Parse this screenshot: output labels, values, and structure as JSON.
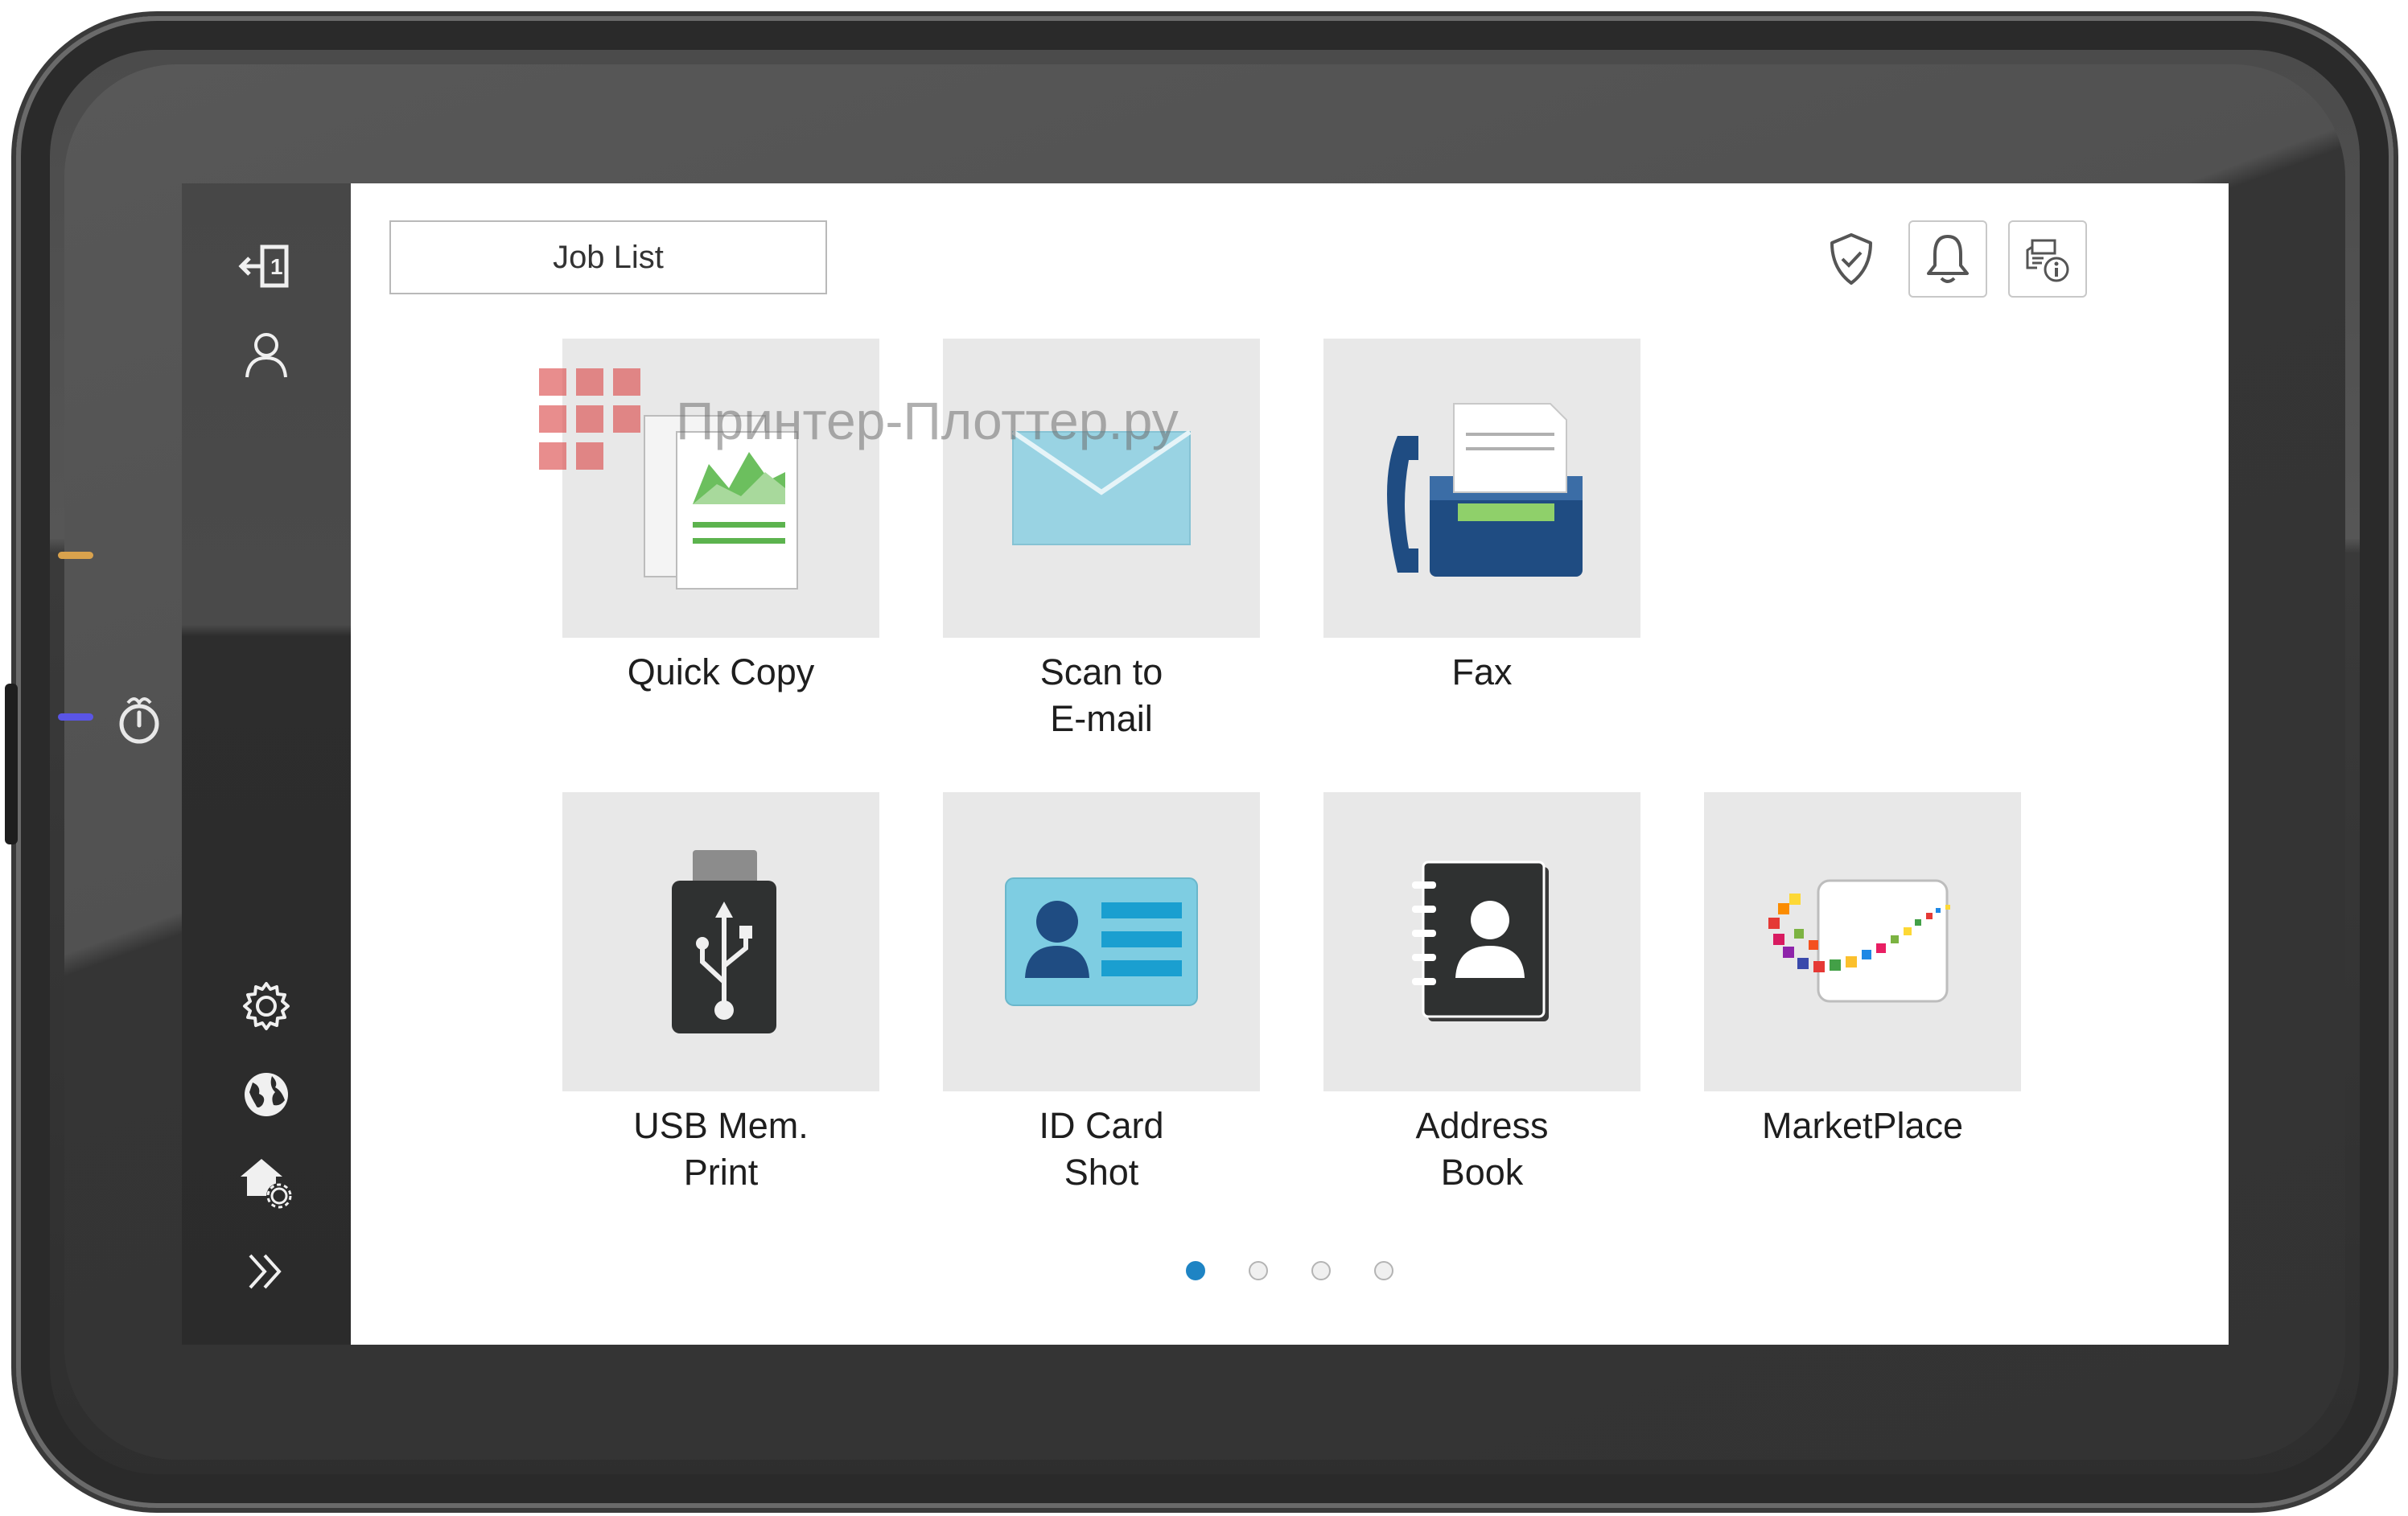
{
  "header": {
    "job_list_label": "Job List"
  },
  "watermark": {
    "text": "Принтер-Плоттер.ру"
  },
  "tiles": [
    {
      "label": "Quick Copy",
      "icon": "copy-icon"
    },
    {
      "label": "Scan to\nE-mail",
      "icon": "envelope-icon"
    },
    {
      "label": "Fax",
      "icon": "fax-icon"
    },
    {
      "label": "USB Mem.\nPrint",
      "icon": "usb-icon"
    },
    {
      "label": "ID Card\nShot",
      "icon": "id-card-icon"
    },
    {
      "label": "Address\nBook",
      "icon": "address-book-icon"
    },
    {
      "label": "MarketPlace",
      "icon": "marketplace-icon"
    }
  ],
  "pager": {
    "pages": 4,
    "current": 1
  },
  "nav_rail": {
    "top": [
      "logout-icon",
      "user-icon"
    ],
    "bottom": [
      "gear-icon",
      "globe-icon",
      "home-settings-icon",
      "double-chevron-right-icon"
    ]
  },
  "colors": {
    "accent": "#1e84c4",
    "tile_bg": "#e8e8e8",
    "fax_blue": "#1f4c82",
    "envelope": "#99d3e3",
    "led_orange": "#d9a24d",
    "led_blue": "#5a55e6"
  }
}
